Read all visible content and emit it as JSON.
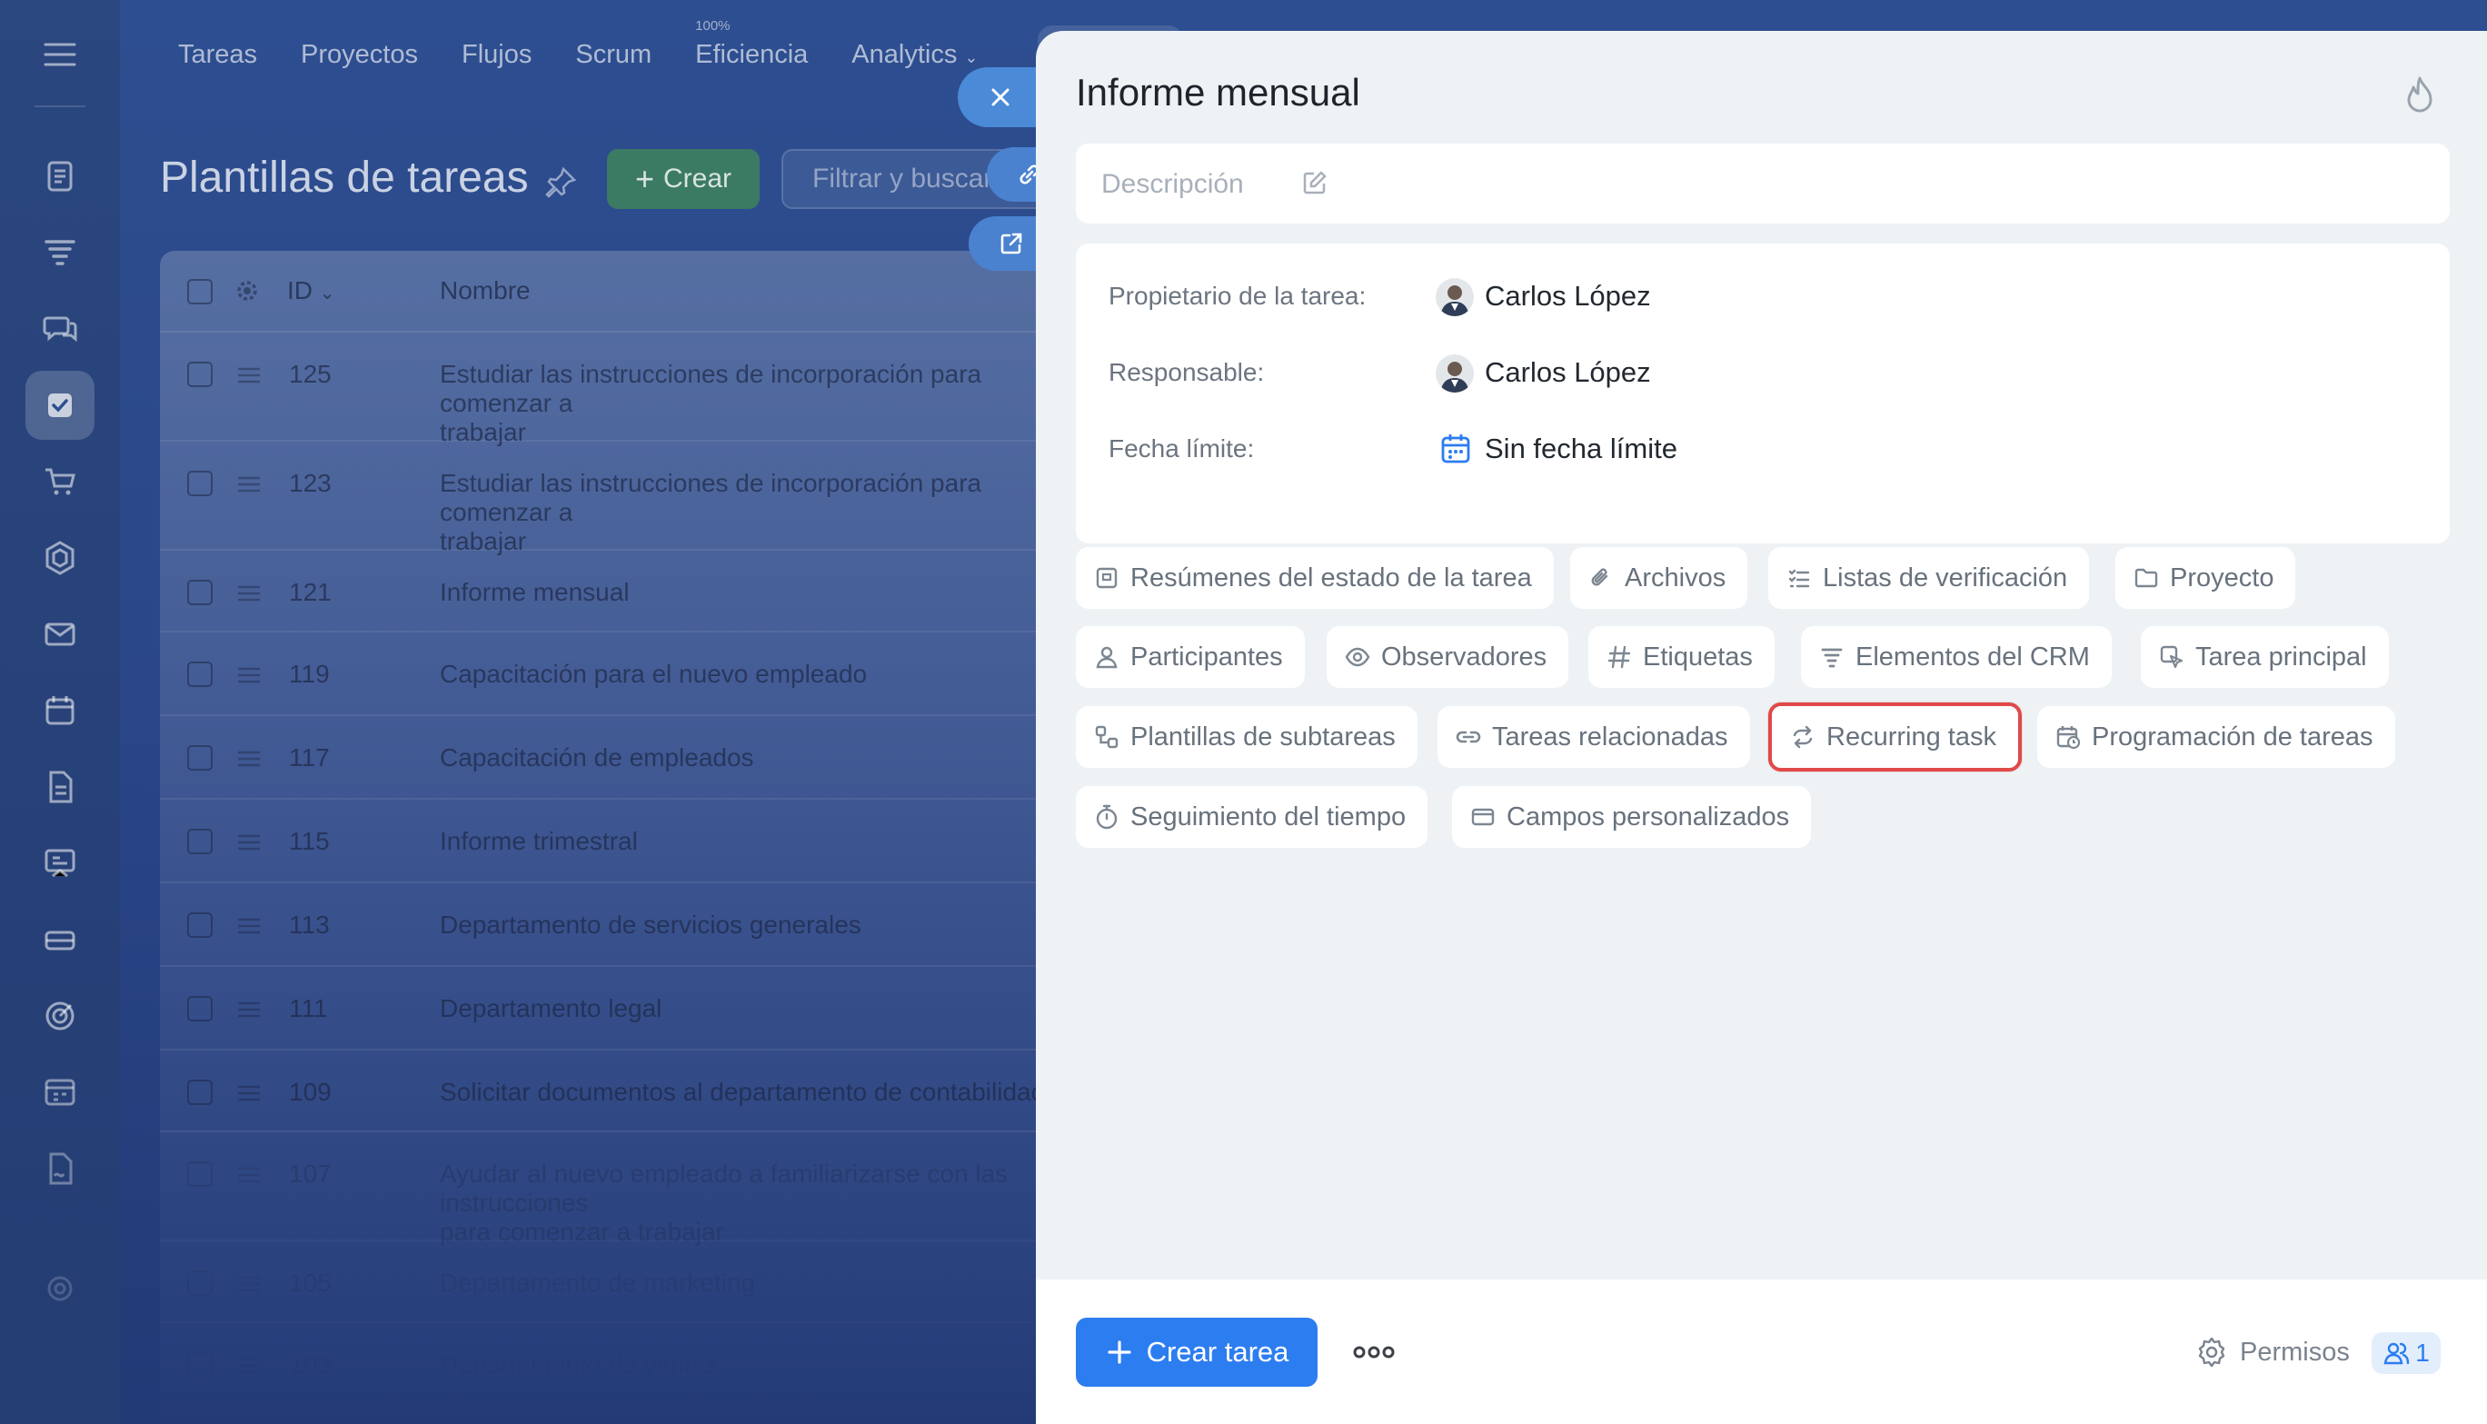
{
  "top_nav": {
    "items": [
      "Tareas",
      "Proyectos",
      "Flujos",
      "Scrum",
      "Eficiencia",
      "Analytics"
    ],
    "eficiencia_badge": "100%"
  },
  "page": {
    "title": "Plantillas de tareas",
    "create_label": "Crear",
    "filter_placeholder": "Filtrar y buscar"
  },
  "grid": {
    "columns": {
      "id": "ID",
      "name": "Nombre"
    },
    "rows": [
      {
        "id": "125",
        "name": "Estudiar las instrucciones de incorporación para comenzar a\ntrabajar"
      },
      {
        "id": "123",
        "name": "Estudiar las instrucciones de incorporación para comenzar a\ntrabajar"
      },
      {
        "id": "121",
        "name": "Informe mensual"
      },
      {
        "id": "119",
        "name": "Capacitación para el nuevo empleado"
      },
      {
        "id": "117",
        "name": "Capacitación de empleados"
      },
      {
        "id": "115",
        "name": "Informe trimestral"
      },
      {
        "id": "113",
        "name": "Departamento de servicios generales"
      },
      {
        "id": "111",
        "name": "Departamento legal"
      },
      {
        "id": "109",
        "name": "Solicitar documentos al departamento de contabilidad"
      },
      {
        "id": "107",
        "name": "Ayudar al nuevo empleado a familiarizarse con las instrucciones\npara comenzar a trabajar"
      },
      {
        "id": "105",
        "name": "Departamento de marketing"
      },
      {
        "id": "103",
        "name": "Departamento de ventas"
      }
    ]
  },
  "panel": {
    "title": "Informe mensual",
    "description_placeholder": "Descripción",
    "properties": {
      "owner_label": "Propietario de la tarea:",
      "owner_value": "Carlos López",
      "responsible_label": "Responsable:",
      "responsible_value": "Carlos López",
      "deadline_label": "Fecha límite:",
      "deadline_value": "Sin fecha límite"
    },
    "chips": {
      "status_summaries": "Resúmenes del estado de la tarea",
      "files": "Archivos",
      "checklists": "Listas de verificación",
      "project": "Proyecto",
      "participants": "Participantes",
      "observers": "Observadores",
      "tags": "Etiquetas",
      "crm_items": "Elementos del CRM",
      "parent_task": "Tarea principal",
      "subtask_templates": "Plantillas de subtareas",
      "related_tasks": "Tareas relacionadas",
      "recurring_task": "Recurring task",
      "task_scheduling": "Programación de tareas",
      "time_tracking": "Seguimiento del tiempo",
      "custom_fields": "Campos personalizados"
    },
    "footer": {
      "create_task_label": "Crear tarea",
      "permissions_label": "Permisos",
      "permissions_count": "1"
    }
  },
  "colors": {
    "primary": "#2c7df0",
    "highlight": "#e0494a",
    "create_button": "#3b7a63"
  }
}
